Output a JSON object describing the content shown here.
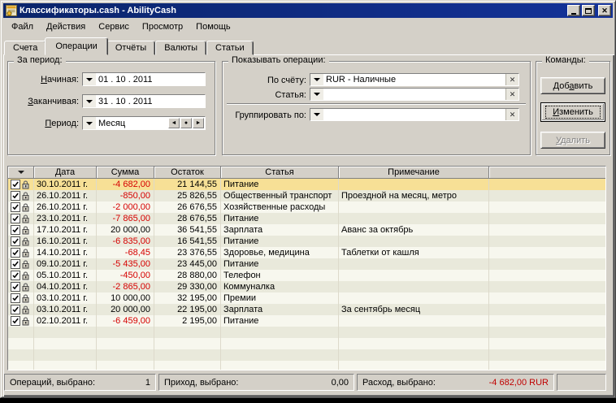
{
  "window": {
    "title": "Классификаторы.cash - AbilityCash"
  },
  "menu": {
    "items": [
      "Файл",
      "Действия",
      "Сервис",
      "Просмотр",
      "Помощь"
    ]
  },
  "tabs": {
    "items": [
      "Счета",
      "Операции",
      "Отчёты",
      "Валюты",
      "Статьи"
    ],
    "active": "Операции"
  },
  "period_group": {
    "title": "За период:",
    "fields": [
      {
        "label": "Начиная:",
        "value": "01 . 10 . 2011"
      },
      {
        "label": "Заканчивая:",
        "value": "31 . 10 . 2011"
      },
      {
        "label": "Период:",
        "value": "Месяц"
      }
    ]
  },
  "filter_group": {
    "title": "Показывать операции:",
    "fields": [
      {
        "label": "По счёту:",
        "value": "RUR - Наличные"
      },
      {
        "label": "Статья:",
        "value": ""
      },
      {
        "label": "Группировать по:",
        "value": ""
      }
    ]
  },
  "commands_group": {
    "title": "Команды:",
    "buttons": [
      {
        "label": "Добавить",
        "state": "normal"
      },
      {
        "label": "Изменить",
        "state": "default-focused"
      },
      {
        "label": "Удалить",
        "state": "disabled"
      }
    ]
  },
  "table": {
    "columns": [
      "",
      "Дата",
      "Сумма",
      "Остаток",
      "Статья",
      "Примечание",
      ""
    ],
    "rows": [
      {
        "checked": true,
        "locked": true,
        "date": "30.10.2011 г.",
        "sum": "-4 682,00",
        "balance": "21 144,55",
        "category": "Питание",
        "note": "",
        "selected": true
      },
      {
        "checked": true,
        "locked": true,
        "date": "26.10.2011 г.",
        "sum": "-850,00",
        "balance": "25 826,55",
        "category": "Общественный транспорт",
        "note": "Проездной на месяц, метро"
      },
      {
        "checked": true,
        "locked": true,
        "date": "26.10.2011 г.",
        "sum": "-2 000,00",
        "balance": "26 676,55",
        "category": "Хозяйственные расходы",
        "note": ""
      },
      {
        "checked": true,
        "locked": true,
        "date": "23.10.2011 г.",
        "sum": "-7 865,00",
        "balance": "28 676,55",
        "category": "Питание",
        "note": ""
      },
      {
        "checked": true,
        "locked": true,
        "date": "17.10.2011 г.",
        "sum": "20 000,00",
        "balance": "36 541,55",
        "category": "Зарплата",
        "note": "Аванс за октябрь"
      },
      {
        "checked": true,
        "locked": true,
        "date": "16.10.2011 г.",
        "sum": "-6 835,00",
        "balance": "16 541,55",
        "category": "Питание",
        "note": ""
      },
      {
        "checked": true,
        "locked": true,
        "date": "14.10.2011 г.",
        "sum": "-68,45",
        "balance": "23 376,55",
        "category": "Здоровье, медицина",
        "note": "Таблетки от кашля"
      },
      {
        "checked": true,
        "locked": true,
        "date": "09.10.2011 г.",
        "sum": "-5 435,00",
        "balance": "23 445,00",
        "category": "Питание",
        "note": ""
      },
      {
        "checked": true,
        "locked": true,
        "date": "05.10.2011 г.",
        "sum": "-450,00",
        "balance": "28 880,00",
        "category": "Телефон",
        "note": ""
      },
      {
        "checked": true,
        "locked": true,
        "date": "04.10.2011 г.",
        "sum": "-2 865,00",
        "balance": "29 330,00",
        "category": "Коммуналка",
        "note": ""
      },
      {
        "checked": true,
        "locked": true,
        "date": "03.10.2011 г.",
        "sum": "10 000,00",
        "balance": "32 195,00",
        "category": "Премии",
        "note": ""
      },
      {
        "checked": true,
        "locked": true,
        "date": "03.10.2011 г.",
        "sum": "20 000,00",
        "balance": "22 195,00",
        "category": "Зарплата",
        "note": "За сентябрь месяц"
      },
      {
        "checked": true,
        "locked": true,
        "date": "02.10.2011 г.",
        "sum": "-6 459,00",
        "balance": "2 195,00",
        "category": "Питание",
        "note": ""
      }
    ]
  },
  "status_bar": {
    "panels": [
      {
        "label": "Операций, выбрано:",
        "value": "1"
      },
      {
        "label": "Приход, выбрано:",
        "value": "0,00"
      },
      {
        "label": "Расход, выбрано:",
        "value": "-4 682,00 RUR",
        "negative": true
      },
      {
        "label": "",
        "value": ""
      }
    ]
  },
  "icons": {
    "clear": "✕",
    "dropdown": "▼",
    "filter": "▼",
    "spin_prev": "◄",
    "spin_dot": "●",
    "spin_next": "►"
  },
  "colors": {
    "window_bg": "#D4D0C8",
    "titlebar": "#0A246A",
    "row_light": "#F7F7EE",
    "row_dark": "#E9E9DB",
    "row_selected": "#F7E096",
    "negative_amount": "#D60000",
    "status_negative": "#C00000"
  }
}
